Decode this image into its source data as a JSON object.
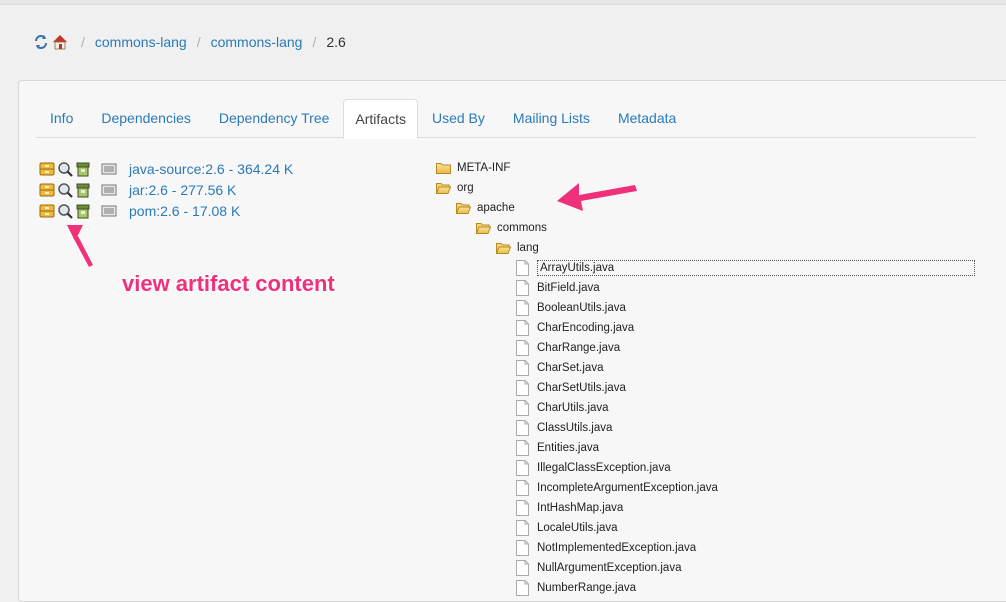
{
  "breadcrumb": {
    "items": [
      "commons-lang",
      "commons-lang"
    ],
    "current": "2.6"
  },
  "tabs": [
    "Info",
    "Dependencies",
    "Dependency Tree",
    "Artifacts",
    "Used By",
    "Mailing Lists",
    "Metadata"
  ],
  "active_tab": "Artifacts",
  "artifacts": [
    "java-source:2.6 - 364.24 K",
    "jar:2.6 - 277.56 K",
    "pom:2.6 - 17.08 K"
  ],
  "annotation": "view artifact content",
  "tree": {
    "meta_inf": "META-INF",
    "org": "org",
    "apache": "apache",
    "commons": "commons",
    "lang": "lang",
    "files": [
      "ArrayUtils.java",
      "BitField.java",
      "BooleanUtils.java",
      "CharEncoding.java",
      "CharRange.java",
      "CharSet.java",
      "CharSetUtils.java",
      "CharUtils.java",
      "ClassUtils.java",
      "Entities.java",
      "IllegalClassException.java",
      "IncompleteArgumentException.java",
      "IntHashMap.java",
      "LocaleUtils.java",
      "NotImplementedException.java",
      "NullArgumentException.java",
      "NumberRange.java"
    ]
  },
  "colors": {
    "link": "#2a7ab8",
    "annotation": "#f0307a"
  },
  "icons": [
    "refresh-icon",
    "home-icon",
    "archive-icon",
    "magnifier-icon",
    "jar-icon",
    "document-icon",
    "folder-icon",
    "file-icon"
  ]
}
